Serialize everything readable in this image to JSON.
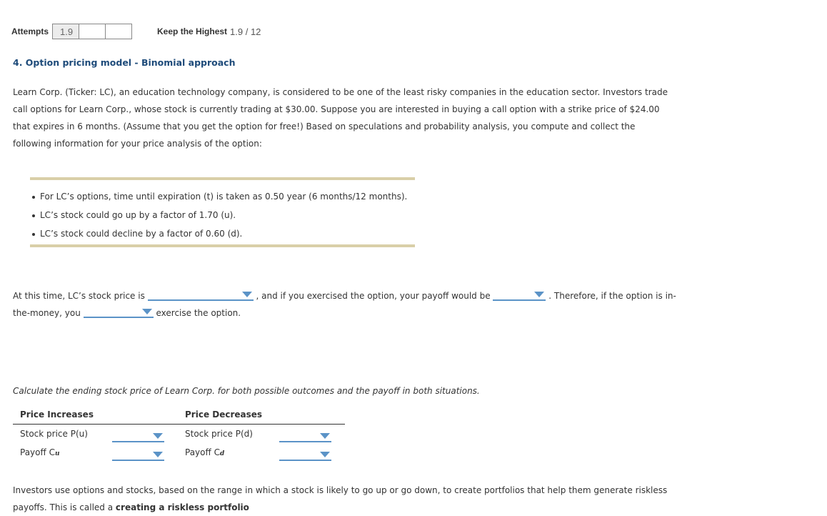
{
  "attempts": {
    "label": "Attempts",
    "boxes": [
      "1.9",
      "",
      ""
    ],
    "keep_label": "Keep the Highest",
    "score": "1.9 / 12"
  },
  "question": {
    "title": "4. Option pricing model - Binomial approach",
    "intro": "Learn Corp. (Ticker: LC), an education technology company, is considered to be one of the least risky companies in the education sector. Investors trade call options for Learn Corp., whose stock is currently trading at $30.00. Suppose you are interested in buying a call option with a strike price of $24.00 that expires in 6 months. (Assume that you get the option for free!) Based on speculations and probability analysis, you compute and collect the following information for your price analysis of the option:",
    "info_items": [
      "For LC’s options, time until expiration (t) is taken as 0.50 year (6 months/12 months).",
      "LC’s stock could go up by a factor of 1.70 (u).",
      "LC’s stock could decline by a factor of 0.60 (d)."
    ]
  },
  "fill_in": {
    "part1": "At this time, LC’s stock price is",
    "part2": ", and if you exercised the option, your payoff would be",
    "part3": ". Therefore, if the option is in-the-money, you",
    "part4": "exercise the option.",
    "dropdowns": {
      "stock_price": "",
      "payoff": "",
      "exercise": ""
    }
  },
  "calc": {
    "intro": "Calculate the ending stock price of Learn Corp. for both possible outcomes and the payoff in both situations.",
    "col_increase": "Price Increases",
    "col_decrease": "Price Decreases",
    "rows": {
      "pu_label": "Stock price P(u)",
      "cu_label": "Payoff C",
      "cu_sub": "u",
      "pd_label": "Stock price P(d)",
      "cd_label": "Payoff C",
      "cd_sub": "d"
    },
    "values": {
      "pu": "",
      "cu": "",
      "pd": "",
      "cd": ""
    }
  },
  "bottom": {
    "text": "Investors use options and stocks, based on the range in which a stock is likely to go up or go down, to create portfolios that help them generate riskless payoffs. This is called a",
    "bold": "creating a riskless portfolio"
  }
}
